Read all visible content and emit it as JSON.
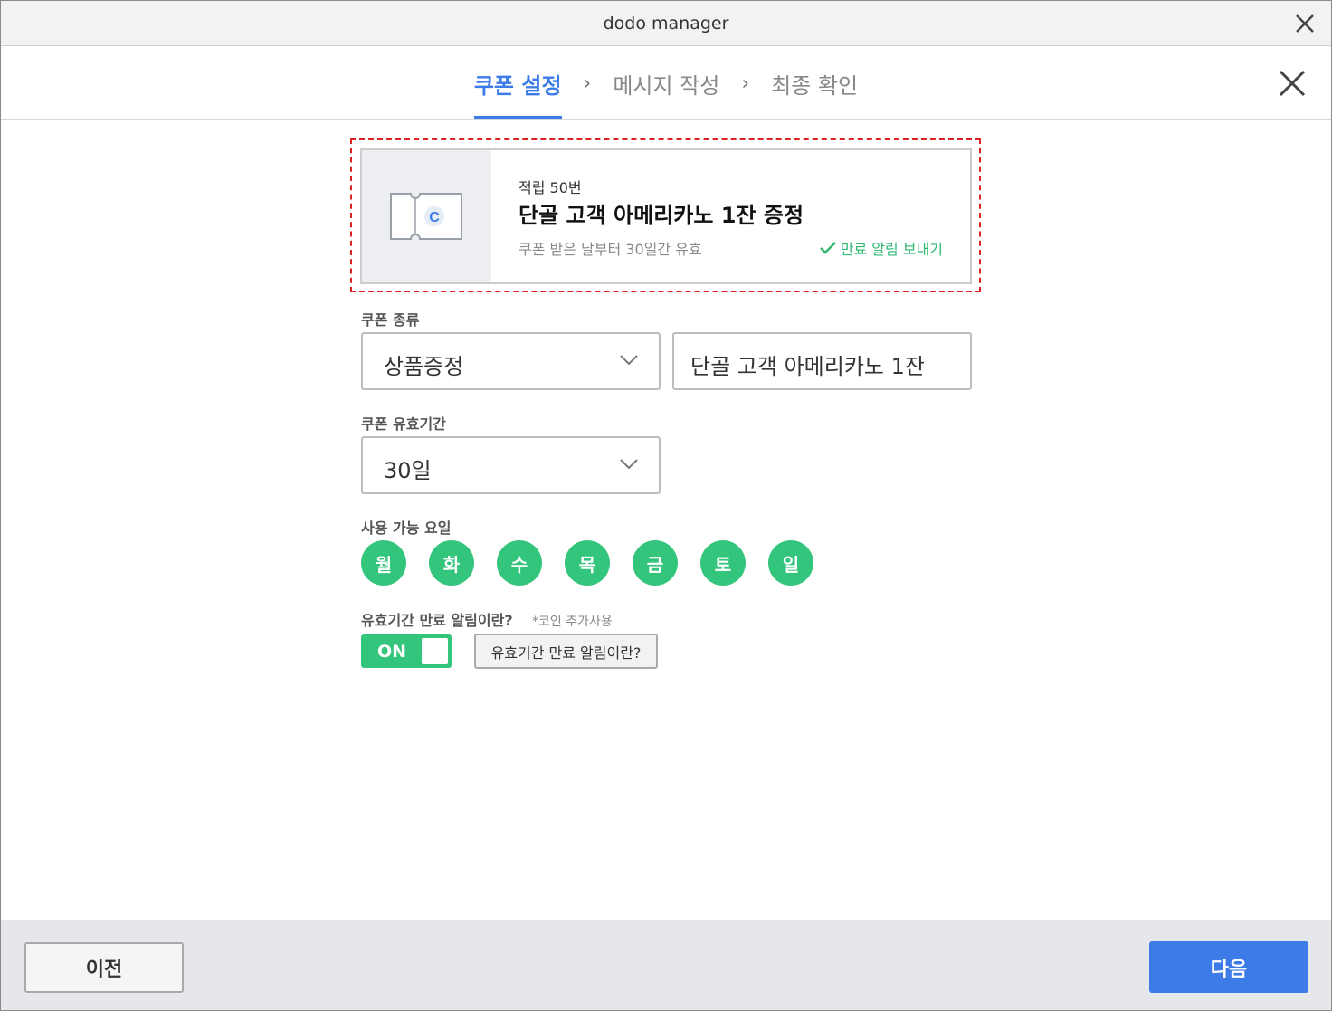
{
  "window": {
    "title": "dodo manager"
  },
  "steps": [
    {
      "label": "쿠폰 설정",
      "active": true
    },
    {
      "label": "메시지 작성",
      "active": false
    },
    {
      "label": "최종 확인",
      "active": false
    }
  ],
  "preview": {
    "small": "적립 50번",
    "title": "단골 고객 아메리카노 1잔 증정",
    "validity": "쿠폰 받은 날부터 30일간 유효",
    "notify": "만료 알림 보내기",
    "coupon_letter": "C"
  },
  "coupon_type": {
    "label": "쿠폰 종류",
    "selected": "상품증정",
    "product_value": "단골 고객 아메리카노 1잔"
  },
  "validity_period": {
    "label": "쿠폰 유효기간",
    "selected": "30일"
  },
  "days": {
    "label": "사용 가능 요일",
    "items": [
      "월",
      "화",
      "수",
      "목",
      "금",
      "토",
      "일"
    ]
  },
  "expiry_alert": {
    "label": "유효기간 만료 알림이란?",
    "note": "*코인 추가사용",
    "toggle": "ON",
    "help_button": "유효기간 만료 알림이란?"
  },
  "footer": {
    "prev": "이전",
    "next": "다음"
  },
  "colors": {
    "accent": "#3d7ce8",
    "green": "#34c57c",
    "highlight": "#dd2222"
  }
}
